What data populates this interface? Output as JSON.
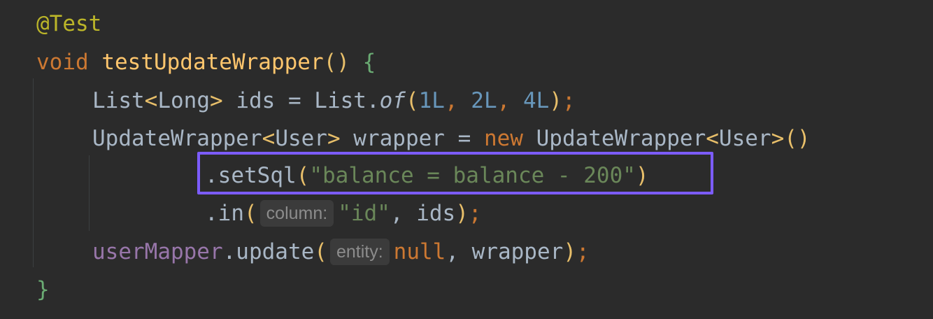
{
  "colors": {
    "background": "#2b2b2b",
    "annotation": "#bbb529",
    "keyword": "#cc7832",
    "method_declaration": "#ffc66d",
    "plain": "#a9b7c6",
    "number": "#6897bb",
    "string": "#6a8759",
    "field": "#9876aa",
    "hint_text": "#8c8c8c",
    "hint_background": "#3b3b3b",
    "highlight_border": "#7c5cff"
  },
  "code": {
    "line1": {
      "annotation": "@Test"
    },
    "line2": {
      "keyword": "void",
      "method": "testUpdateWrapper",
      "parens": "()",
      "brace": "{"
    },
    "line3": {
      "type": "List",
      "lt": "<",
      "generic": "Long",
      "gt": ">",
      "rest1": " ids = List.",
      "method": "of",
      "open": "(",
      "n1": "1L",
      "sep1": ", ",
      "n2": "2L",
      "sep2": ", ",
      "n3": "4L",
      "close": ")",
      "semicolon": ";"
    },
    "line4": {
      "type": "UpdateWrapper",
      "lt": "<",
      "generic": "User",
      "gt": ">",
      "rest1": " wrapper = ",
      "keyword": "new",
      "type2": " UpdateWrapper",
      "lt2": "<",
      "generic2": "User",
      "gt2": ">",
      "parens": "()"
    },
    "line5": {
      "method": ".setSql",
      "open": "(",
      "string": "\"balance = balance - 200\"",
      "close": ")"
    },
    "line6": {
      "method": ".in",
      "open": "(",
      "hint": "column:",
      "string": "\"id\"",
      "rest": ", ids",
      "close": ")",
      "semicolon": ";"
    },
    "line7": {
      "field": "userMapper",
      "method": ".update",
      "open": "(",
      "hint": "entity:",
      "keyword": "null",
      "rest": ", wrapper",
      "close": ")",
      "semicolon": ";"
    },
    "line8": {
      "brace": "}"
    }
  }
}
